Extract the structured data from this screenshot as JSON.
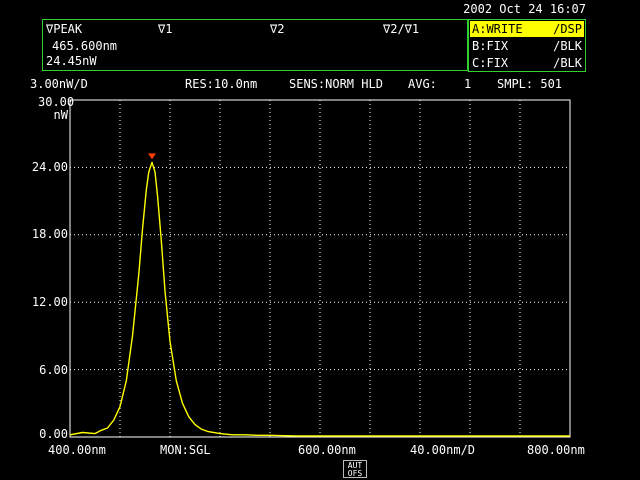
{
  "datetime": "2002 Oct 24 16:07",
  "marker_panel": {
    "col_labels": [
      "∇PEAK",
      "∇1",
      "∇2",
      "∇2/∇1"
    ],
    "wavelength": "465.600nm",
    "power": "24.45nW"
  },
  "traces": [
    {
      "name": "A:WRITE",
      "mode": "/DSP",
      "active": true
    },
    {
      "name": "B:FIX",
      "mode": "/BLK",
      "active": false
    },
    {
      "name": "C:FIX",
      "mode": "/BLK",
      "active": false
    }
  ],
  "status": {
    "scale": "3.00nW/D",
    "res": "RES:10.0nm",
    "sens": "SENS:NORM HLD",
    "avg_label": "AVG:",
    "avg_value": "1",
    "smpl": "SMPL: 501"
  },
  "y_axis": {
    "top_label": "30.00",
    "unit": "nW",
    "ticks": [
      "24.00",
      "18.00",
      "12.00",
      "6.00",
      "0.00"
    ]
  },
  "x_axis": {
    "start": "400.00nm",
    "mon": "MON:SGL",
    "center": "600.00nm",
    "span": "40.00nm/D",
    "stop": "800.00nm"
  },
  "auto_ofs": {
    "line1": "AUT",
    "line2": "OFS"
  },
  "colors": {
    "trace": "#ffff00",
    "marker": "#ff4000",
    "grid": "#ffffff",
    "panel_border": "#2fd02f",
    "active_trace_bg": "#ffff00"
  },
  "chart_data": {
    "type": "line",
    "x_unit": "nm",
    "y_unit": "nW",
    "xlim": [
      400,
      800
    ],
    "ylim": [
      0,
      30
    ],
    "series": [
      {
        "x": [
          400,
          410,
          420,
          425,
          430,
          435,
          440,
          445,
          450,
          455,
          458,
          461,
          463,
          465.6,
          468,
          470,
          473,
          476,
          480,
          485,
          490,
          495,
          500,
          505,
          510,
          520,
          530,
          540,
          550,
          560,
          580,
          600,
          620,
          640,
          660,
          680,
          700,
          720,
          740,
          760,
          780,
          800
        ],
        "y": [
          0.2,
          0.4,
          0.3,
          0.6,
          0.8,
          1.5,
          2.7,
          5.0,
          9.0,
          14.5,
          18.5,
          22.0,
          23.6,
          24.45,
          23.6,
          21.5,
          17.5,
          13.0,
          8.5,
          5.0,
          3.0,
          1.8,
          1.1,
          0.7,
          0.5,
          0.3,
          0.2,
          0.2,
          0.15,
          0.15,
          0.1,
          0.1,
          0.1,
          0.1,
          0.1,
          0.1,
          0.1,
          0.1,
          0.1,
          0.1,
          0.1,
          0.1
        ]
      }
    ],
    "peak_marker": {
      "x": 465.6,
      "y": 24.45
    }
  }
}
